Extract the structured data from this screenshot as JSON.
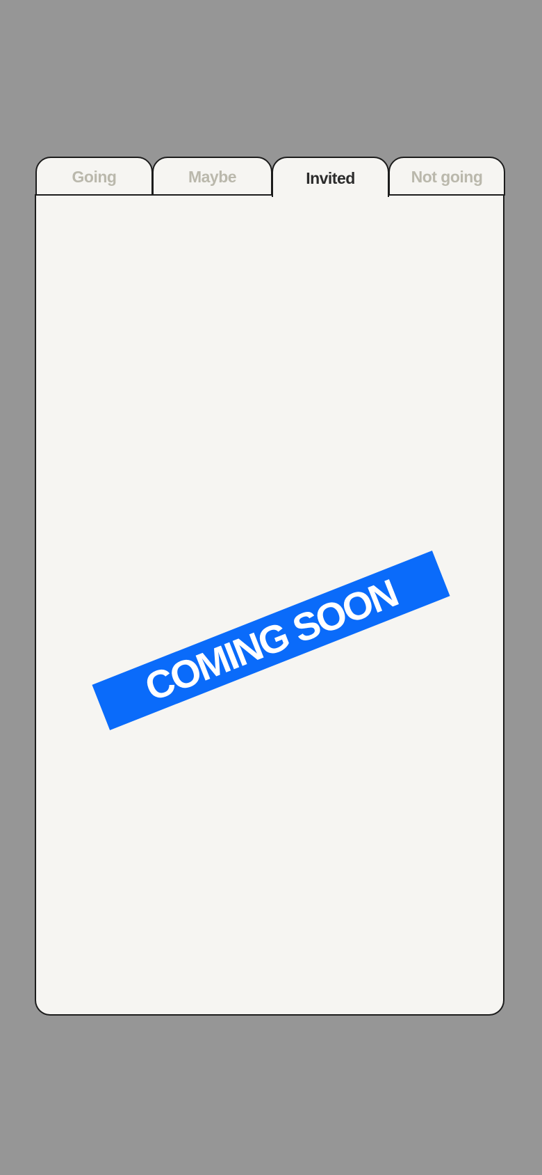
{
  "tabs": [
    {
      "label": "Going",
      "active": false
    },
    {
      "label": "Maybe",
      "active": false
    },
    {
      "label": "Invited",
      "active": true
    },
    {
      "label": "Not going",
      "active": false
    }
  ],
  "banner": {
    "text": "COMING SOON"
  },
  "colors": {
    "background": "#969696",
    "card": "#f6f5f2",
    "border": "#1c1c1c",
    "tab_inactive_text": "#bab8ac",
    "tab_active_text": "#2b2b2b",
    "banner": "#0a6bfa",
    "banner_text": "#ffffff"
  }
}
